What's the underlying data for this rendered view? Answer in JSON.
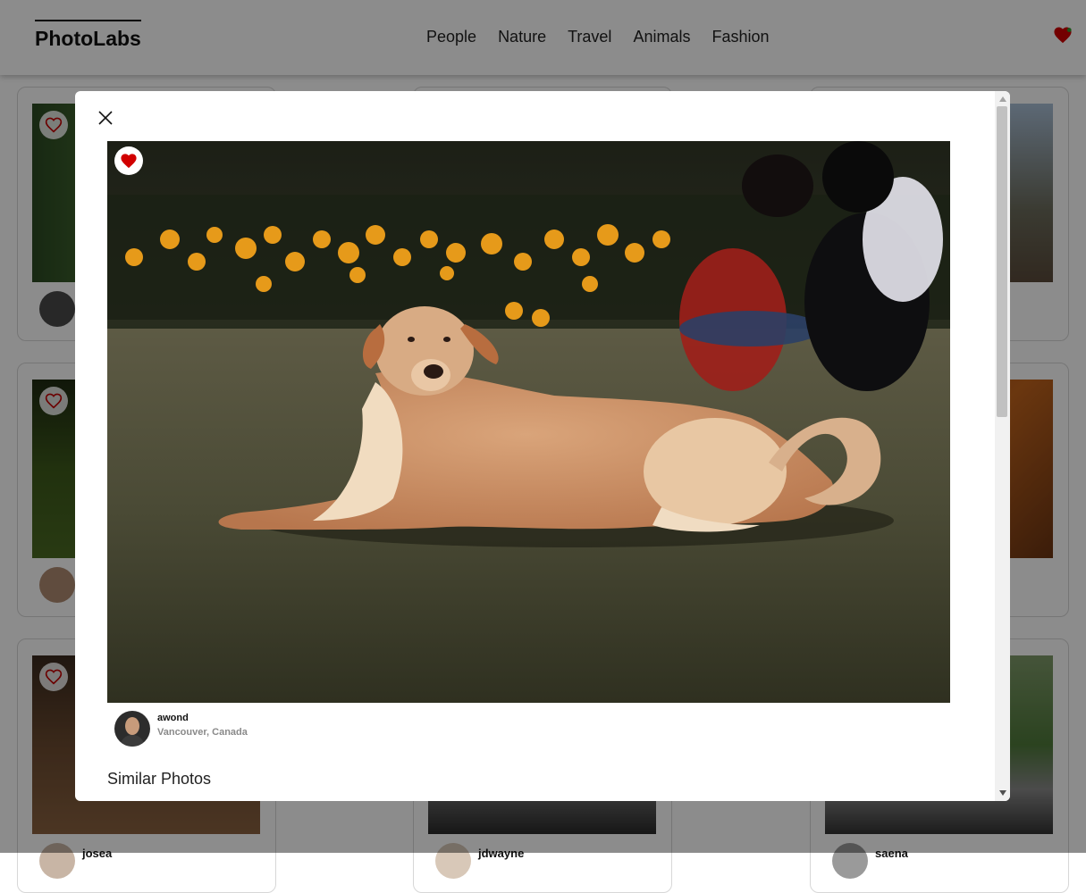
{
  "app": {
    "logo": "PhotoLabs"
  },
  "nav": {
    "topics": [
      "People",
      "Nature",
      "Travel",
      "Animals",
      "Fashion"
    ]
  },
  "grid": {
    "bottom_row_users": [
      "josea",
      "jdwayne",
      "saena"
    ]
  },
  "modal": {
    "photo": {
      "favorited": true,
      "subject": "tan dog lying on grass with orange flowers and people in background"
    },
    "owner": {
      "username": "awond",
      "location": "Vancouver, Canada"
    },
    "similar_title": "Similar Photos"
  },
  "colors": {
    "heart_red": "#d10000",
    "nav_text": "#222222"
  },
  "icons": [
    "heart-icon",
    "close-icon",
    "heart-outline-icon"
  ]
}
